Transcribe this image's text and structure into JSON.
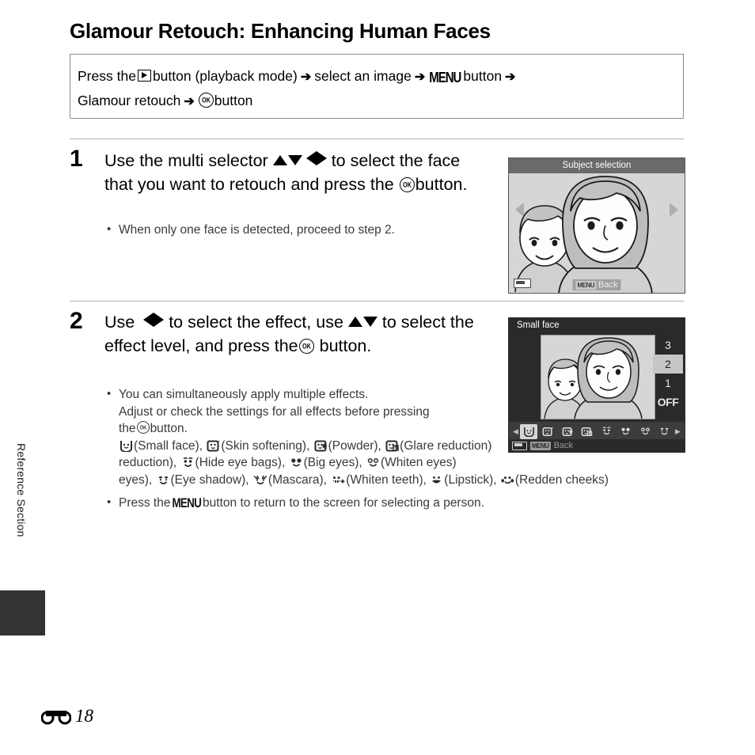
{
  "page": {
    "title": "Glamour Retouch: Enhancing Human Faces",
    "side_label": "Reference Section",
    "page_number": "18",
    "page_section_icon": "reference-section-e-icon"
  },
  "path_box": {
    "line1_a": "Press the",
    "line1_play_icon": "playback-button-icon",
    "line1_b": "button (playback mode)",
    "arrow": "➔",
    "line1_c": "select an image",
    "line1_menu": "MENU",
    "line1_d": "button",
    "line2_a": "Glamour retouch",
    "line2_ok_icon": "ok-button-icon",
    "line2_b": "button"
  },
  "steps": [
    {
      "number": "1",
      "text_a": "Use the multi selector",
      "text_b": "to select the face that you want to retouch and press the",
      "text_c": "button.",
      "bullets": [
        {
          "text": "When only one face is detected, proceed to step 2."
        }
      ]
    },
    {
      "number": "2",
      "text_a": "Use",
      "text_b": "to select the effect, use",
      "text_c": "to select the effect level, and press the",
      "text_d": "button.",
      "bullets": [
        {
          "line1": "You can simultaneously apply multiple effects.",
          "line2": "Adjust or check the settings for all effects before pressing",
          "line3_a": "the",
          "line3_b": "button.",
          "effects_intro": "",
          "effects": [
            {
              "icon": "small-face-icon",
              "label": "(Small face)"
            },
            {
              "icon": "skin-softening-icon",
              "label": "(Skin softening)"
            },
            {
              "icon": "powder-icon",
              "label": "(Powder)"
            },
            {
              "icon": "glare-reduction-icon",
              "label": "(Glare reduction)"
            },
            {
              "icon": "hide-eye-bags-icon",
              "label": "(Hide eye bags)"
            },
            {
              "icon": "big-eyes-icon",
              "label": "(Big eyes)"
            },
            {
              "icon": "whiten-eyes-icon",
              "label": "(Whiten eyes)"
            },
            {
              "icon": "eye-shadow-icon",
              "label": "(Eye shadow)"
            },
            {
              "icon": "mascara-icon",
              "label": "(Mascara)"
            },
            {
              "icon": "whiten-teeth-icon",
              "label": "(Whiten teeth)"
            },
            {
              "icon": "lipstick-icon",
              "label": "(Lipstick)"
            },
            {
              "icon": "redden-cheeks-icon",
              "label": "(Redden cheeks)"
            }
          ]
        },
        {
          "text_a": "Press the",
          "menu": "MENU",
          "text_b": "button to return to the screen for selecting a person."
        }
      ]
    }
  ],
  "screen1": {
    "title": "Subject selection",
    "back_label": "Back",
    "back_menu_icon": "menu-button-icon",
    "battery_icon": "battery-icon",
    "left_arrow_icon": "nav-left-arrow-icon",
    "right_arrow_icon": "nav-right-arrow-icon"
  },
  "screen2": {
    "title": "Small face",
    "levels": [
      "3",
      "2",
      "1",
      "OFF"
    ],
    "selected_level": "2",
    "effect_icons": [
      "small-face-icon",
      "skin-softening-icon",
      "powder-icon",
      "glare-reduction-icon",
      "hide-eye-bags-icon",
      "big-eyes-icon",
      "whiten-eyes-icon",
      "eye-shadow-icon"
    ],
    "selected_effect_index": 0,
    "scroll_left_icon": "scroll-left-arrow-icon",
    "scroll_right_icon": "scroll-right-arrow-icon",
    "back_label": "Back",
    "back_menu_icon": "menu-button-icon",
    "battery_icon": "battery-icon"
  },
  "colors": {
    "screen1_header": "#6a6a6a",
    "screen2_bg": "#2a2a2a",
    "selection_highlight": "#c6c6c6",
    "rule": "#b0b0b0",
    "side_tab": "#333333"
  }
}
